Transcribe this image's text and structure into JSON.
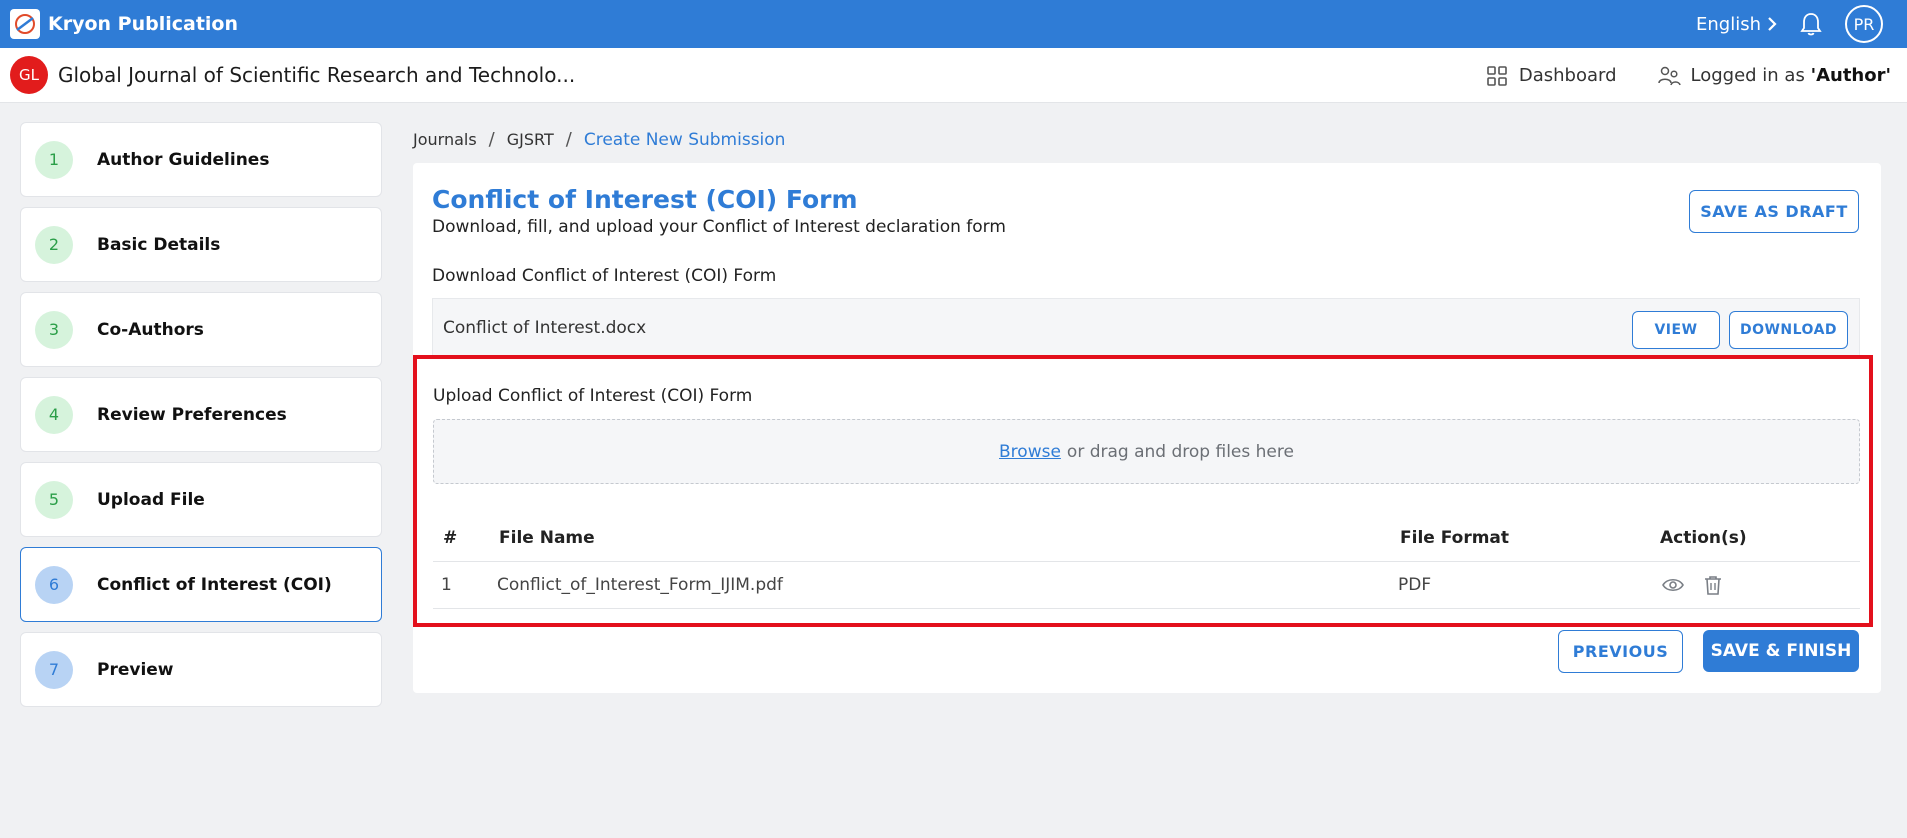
{
  "topbar": {
    "brand": "Kryon Publication",
    "language": "English",
    "user_initials": "PR"
  },
  "journal": {
    "badge": "GL",
    "title": "Global Journal of Scientific Research and Technolo...",
    "dashboard_label": "Dashboard",
    "logged_prefix": "Logged in as ",
    "logged_role": "'Author'"
  },
  "steps": [
    {
      "num": "1",
      "label": "Author Guidelines"
    },
    {
      "num": "2",
      "label": "Basic Details"
    },
    {
      "num": "3",
      "label": "Co-Authors"
    },
    {
      "num": "4",
      "label": "Review Preferences"
    },
    {
      "num": "5",
      "label": "Upload File"
    },
    {
      "num": "6",
      "label": "Conflict of Interest (COI)"
    },
    {
      "num": "7",
      "label": "Preview"
    }
  ],
  "breadcrumb": {
    "journals": "Journals",
    "sep": "/",
    "journal": "GJSRT",
    "current": "Create New Submission"
  },
  "form": {
    "title": "Conflict of Interest (COI) Form",
    "subtitle": "Download, fill, and upload your Conflict of Interest declaration form",
    "save_draft": "SAVE AS DRAFT",
    "download_label": "Download Conflict of Interest (COI) Form",
    "template_file": "Conflict of Interest.docx",
    "view_label": "VIEW",
    "download_btn": "DOWNLOAD",
    "upload_label": "Upload Conflict of Interest (COI) Form",
    "browse": "Browse",
    "drop_text": "or drag and drop files here",
    "table": {
      "headers": [
        "#",
        "File Name",
        "File Format",
        "Action(s)"
      ],
      "rows": [
        {
          "num": "1",
          "name": "Conflict_of_Interest_Form_IJIM.pdf",
          "format": "PDF"
        }
      ]
    },
    "previous": "PREVIOUS",
    "finish": "SAVE & FINISH"
  },
  "colors": {
    "primary": "#2f7cd6",
    "highlight": "#e3101c",
    "badge_red": "#e21c1c",
    "step_green_bg": "#d6f3dc",
    "step_blue_bg": "#b8d3f4"
  }
}
